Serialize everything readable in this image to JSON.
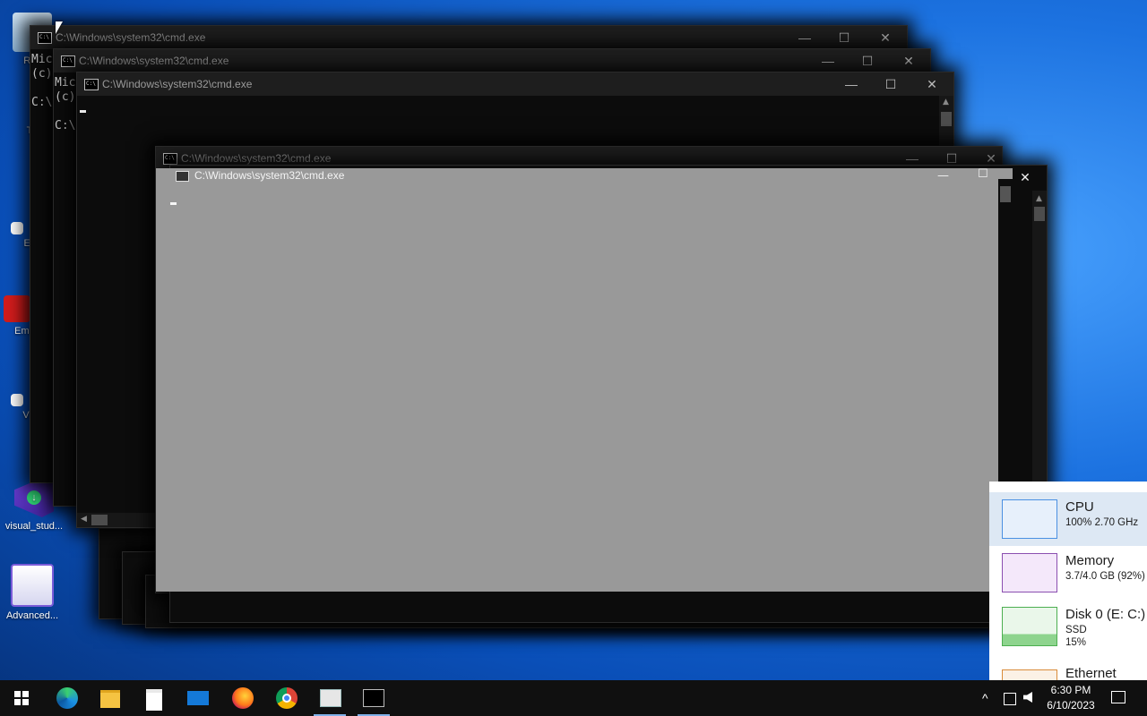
{
  "desktop": {
    "icons": [
      {
        "label": "Rec"
      },
      {
        "label": "Th"
      },
      {
        "label": "Eve"
      },
      {
        "label": "Emb De"
      },
      {
        "label": "Visu"
      },
      {
        "label": "visual_stud..."
      },
      {
        "label": "Advanced..."
      }
    ]
  },
  "cmd_windows": [
    {
      "title": "C:\\Windows\\system32\\cmd.exe",
      "text": "Mic\n(c)\n\nC:\\"
    },
    {
      "title": "C:\\Windows\\system32\\cmd.exe",
      "text": "Mic\n(c)\n\nC:\\"
    },
    {
      "title": "C:\\Windows\\system32\\cmd.exe"
    },
    {
      "title": "C:\\Windows\\system32\\cmd.exe"
    },
    {
      "title": "C:\\Windows\\system32\\cmd.exe"
    }
  ],
  "window_controls": {
    "minimize": "—",
    "maximize": "☐",
    "close": "✕"
  },
  "task_manager": {
    "cpu": {
      "name": "CPU",
      "detail": "100% 2.70 GHz"
    },
    "memory": {
      "name": "Memory",
      "detail": "3.7/4.0 GB (92%)"
    },
    "disk": {
      "name": "Disk 0 (E: C:)",
      "detail1": "SSD",
      "detail2": "15%"
    },
    "ethernet": {
      "name": "Ethernet"
    }
  },
  "taskbar": {
    "pinned": [
      "start-icon",
      "edge-icon",
      "file-explorer-icon",
      "store-icon",
      "mail-icon",
      "firefox-icon",
      "chrome-icon",
      "task-manager-icon",
      "cmd-icon"
    ],
    "clock_time": "6:30 PM",
    "clock_date": "6/10/2023",
    "tray_chevron": "^"
  },
  "colors": {
    "desktop_accent": "#1c72e0",
    "console_bg": "#0c0c0c",
    "focused_console_bg": "#999999"
  }
}
